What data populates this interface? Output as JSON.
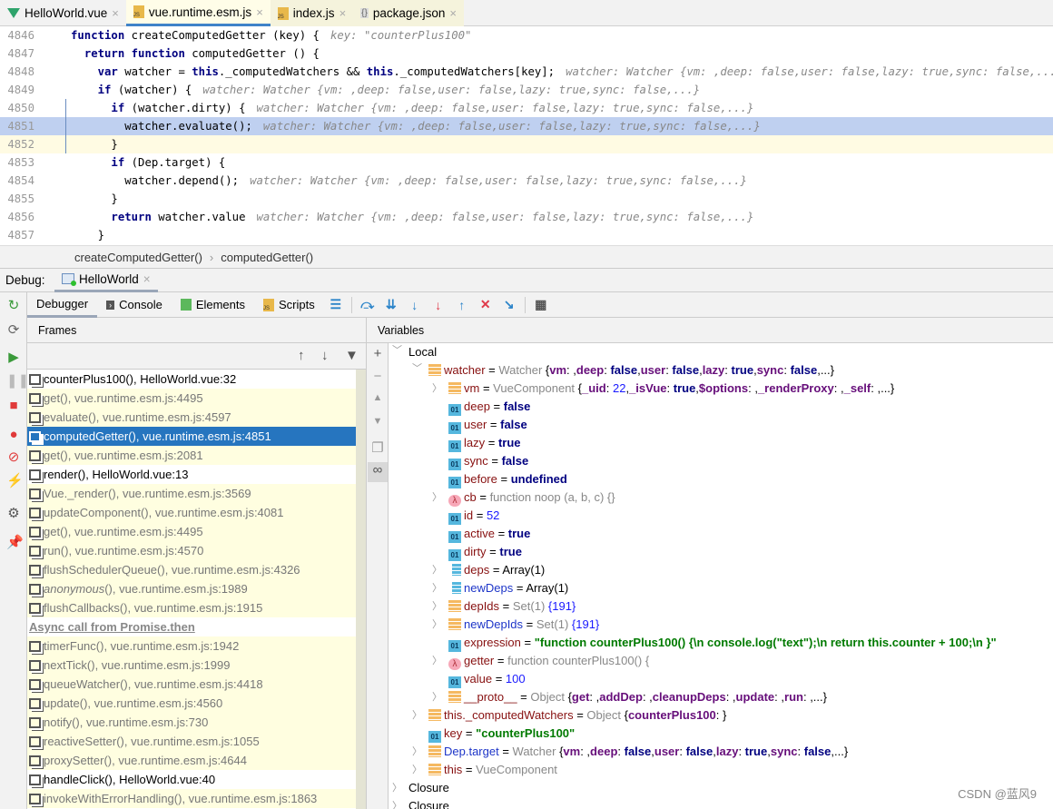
{
  "tabs": [
    {
      "label": "HelloWorld.vue",
      "icon": "vue-icon",
      "state": ""
    },
    {
      "label": "vue.runtime.esm.js",
      "icon": "js-file-icon",
      "state": "active"
    },
    {
      "label": "index.js",
      "icon": "js-file-icon",
      "state": "yellow"
    },
    {
      "label": "package.json",
      "icon": "json-file-icon",
      "state": "yellow"
    }
  ],
  "code": [
    {
      "num": "4846",
      "code": "function createComputedGetter (key) {",
      "hint": "key: \"counterPlus100\"",
      "state": ""
    },
    {
      "num": "4847",
      "code": "  return function computedGetter () {",
      "hint": "",
      "state": ""
    },
    {
      "num": "4848",
      "code": "    var watcher = this._computedWatchers && this._computedWatchers[key];",
      "hint": "watcher: Watcher {vm: ,deep: false,user: false,lazy: true,sync: false,...}  key: ",
      "state": ""
    },
    {
      "num": "4849",
      "code": "    if (watcher) {",
      "hint": "watcher: Watcher {vm: ,deep: false,user: false,lazy: true,sync: false,...}",
      "state": ""
    },
    {
      "num": "4850",
      "code": "      if (watcher.dirty) {",
      "hint": "watcher: Watcher {vm: ,deep: false,user: false,lazy: true,sync: false,...}",
      "state": ""
    },
    {
      "num": "4851",
      "code": "        watcher.evaluate();",
      "hint": "watcher: Watcher {vm: ,deep: false,user: false,lazy: true,sync: false,...}",
      "state": "exec"
    },
    {
      "num": "4852",
      "code": "      }",
      "hint": "",
      "state": "cur"
    },
    {
      "num": "4853",
      "code": "      if (Dep.target) {",
      "hint": "",
      "state": ""
    },
    {
      "num": "4854",
      "code": "        watcher.depend();",
      "hint": "watcher: Watcher {vm: ,deep: false,user: false,lazy: true,sync: false,...}",
      "state": ""
    },
    {
      "num": "4855",
      "code": "      }",
      "hint": "",
      "state": ""
    },
    {
      "num": "4856",
      "code": "      return watcher.value",
      "hint": "watcher: Watcher {vm: ,deep: false,user: false,lazy: true,sync: false,...}",
      "state": ""
    },
    {
      "num": "4857",
      "code": "    }",
      "hint": "",
      "state": ""
    }
  ],
  "breadcrumb": [
    "createComputedGetter()",
    "computedGetter()"
  ],
  "debug": {
    "label": "Debug:",
    "session": "HelloWorld"
  },
  "toolbar_tabs": [
    "Debugger",
    "Console",
    "Elements",
    "Scripts"
  ],
  "panels": {
    "frames": "Frames",
    "variables": "Variables"
  },
  "frames": [
    {
      "label": "counterPlus100(), HelloWorld.vue:32",
      "s": "w"
    },
    {
      "label": "get(), vue.runtime.esm.js:4495",
      "s": "y"
    },
    {
      "label": "evaluate(), vue.runtime.esm.js:4597",
      "s": "y"
    },
    {
      "label": "computedGetter(), vue.runtime.esm.js:4851",
      "s": "sel"
    },
    {
      "label": "get(), vue.runtime.esm.js:2081",
      "s": "y"
    },
    {
      "label": "render(), HelloWorld.vue:13",
      "s": "w"
    },
    {
      "label": "Vue._render(), vue.runtime.esm.js:3569",
      "s": "y"
    },
    {
      "label": "updateComponent(), vue.runtime.esm.js:4081",
      "s": "y"
    },
    {
      "label": "get(), vue.runtime.esm.js:4495",
      "s": "y"
    },
    {
      "label": "run(), vue.runtime.esm.js:4570",
      "s": "y"
    },
    {
      "label": "flushSchedulerQueue(), vue.runtime.esm.js:4326",
      "s": "y"
    },
    {
      "label": "anonymous(), vue.runtime.esm.js:1989",
      "s": "y"
    },
    {
      "label": "flushCallbacks(), vue.runtime.esm.js:1915",
      "s": "y"
    },
    {
      "label": "Async call from Promise.then",
      "s": "async"
    },
    {
      "label": "timerFunc(), vue.runtime.esm.js:1942",
      "s": "y"
    },
    {
      "label": "nextTick(), vue.runtime.esm.js:1999",
      "s": "y"
    },
    {
      "label": "queueWatcher(), vue.runtime.esm.js:4418",
      "s": "y"
    },
    {
      "label": "update(), vue.runtime.esm.js:4560",
      "s": "y"
    },
    {
      "label": "notify(), vue.runtime.esm.js:730",
      "s": "y"
    },
    {
      "label": "reactiveSetter(), vue.runtime.esm.js:1055",
      "s": "y"
    },
    {
      "label": "proxySetter(), vue.runtime.esm.js:4644",
      "s": "y"
    },
    {
      "label": "handleClick(), HelloWorld.vue:40",
      "s": "w"
    },
    {
      "label": "invokeWithErrorHandling(), vue.runtime.esm.js:1863",
      "s": "y"
    }
  ],
  "variables": [
    {
      "lvl": 0,
      "arrow": "open",
      "icon": "",
      "segs": [
        [
          "Local",
          "plain"
        ]
      ]
    },
    {
      "lvl": 1,
      "arrow": "open",
      "icon": "obj",
      "segs": [
        [
          "watcher",
          "name"
        ],
        [
          " = ",
          "plain"
        ],
        [
          "Watcher ",
          "gray"
        ],
        [
          "{",
          "plain"
        ],
        [
          "vm",
          "key"
        ],
        [
          ": ,",
          "plain"
        ],
        [
          "deep",
          "key"
        ],
        [
          ": ",
          "plain"
        ],
        [
          "false",
          "kw"
        ],
        [
          ",",
          "plain"
        ],
        [
          "user",
          "key"
        ],
        [
          ": ",
          "plain"
        ],
        [
          "false",
          "kw"
        ],
        [
          ",",
          "plain"
        ],
        [
          "lazy",
          "key"
        ],
        [
          ": ",
          "plain"
        ],
        [
          "true",
          "kw"
        ],
        [
          ",",
          "plain"
        ],
        [
          "sync",
          "key"
        ],
        [
          ": ",
          "plain"
        ],
        [
          "false",
          "kw"
        ],
        [
          ",...}",
          "plain"
        ]
      ]
    },
    {
      "lvl": 2,
      "arrow": "closed",
      "icon": "obj",
      "segs": [
        [
          "vm",
          "name"
        ],
        [
          " = ",
          "plain"
        ],
        [
          "VueComponent ",
          "gray"
        ],
        [
          "{",
          "plain"
        ],
        [
          "_uid",
          "key"
        ],
        [
          ": ",
          "plain"
        ],
        [
          "22",
          "num"
        ],
        [
          ",",
          "plain"
        ],
        [
          "_isVue",
          "key"
        ],
        [
          ": ",
          "plain"
        ],
        [
          "true",
          "kw"
        ],
        [
          ",",
          "plain"
        ],
        [
          "$options",
          "key"
        ],
        [
          ": ,",
          "plain"
        ],
        [
          "_renderProxy",
          "key"
        ],
        [
          ": ,",
          "plain"
        ],
        [
          "_self",
          "key"
        ],
        [
          ": ,...}",
          "plain"
        ]
      ]
    },
    {
      "lvl": 2,
      "arrow": "",
      "icon": "prim",
      "segs": [
        [
          "deep",
          "name"
        ],
        [
          " = ",
          "plain"
        ],
        [
          "false",
          "kw"
        ]
      ]
    },
    {
      "lvl": 2,
      "arrow": "",
      "icon": "prim",
      "segs": [
        [
          "user",
          "name"
        ],
        [
          " = ",
          "plain"
        ],
        [
          "false",
          "kw"
        ]
      ]
    },
    {
      "lvl": 2,
      "arrow": "",
      "icon": "prim",
      "segs": [
        [
          "lazy",
          "name"
        ],
        [
          " = ",
          "plain"
        ],
        [
          "true",
          "kw"
        ]
      ]
    },
    {
      "lvl": 2,
      "arrow": "",
      "icon": "prim",
      "segs": [
        [
          "sync",
          "name"
        ],
        [
          " = ",
          "plain"
        ],
        [
          "false",
          "kw"
        ]
      ]
    },
    {
      "lvl": 2,
      "arrow": "",
      "icon": "prim",
      "segs": [
        [
          "before",
          "name"
        ],
        [
          " = ",
          "plain"
        ],
        [
          "undefined",
          "kw"
        ]
      ]
    },
    {
      "lvl": 2,
      "arrow": "closed",
      "icon": "fn",
      "segs": [
        [
          "cb",
          "name"
        ],
        [
          " = ",
          "plain"
        ],
        [
          "function noop (a, b, c) {}",
          "gray"
        ]
      ]
    },
    {
      "lvl": 2,
      "arrow": "",
      "icon": "prim",
      "segs": [
        [
          "id",
          "name"
        ],
        [
          " = ",
          "plain"
        ],
        [
          "52",
          "num"
        ]
      ]
    },
    {
      "lvl": 2,
      "arrow": "",
      "icon": "prim",
      "segs": [
        [
          "active",
          "name"
        ],
        [
          " = ",
          "plain"
        ],
        [
          "true",
          "kw"
        ]
      ]
    },
    {
      "lvl": 2,
      "arrow": "",
      "icon": "prim",
      "segs": [
        [
          "dirty",
          "name"
        ],
        [
          " = ",
          "plain"
        ],
        [
          "true",
          "kw"
        ]
      ]
    },
    {
      "lvl": 2,
      "arrow": "closed",
      "icon": "arrx",
      "segs": [
        [
          "deps",
          "name"
        ],
        [
          " = ",
          "plain"
        ],
        [
          "Array(1)",
          "plain"
        ]
      ]
    },
    {
      "lvl": 2,
      "arrow": "closed",
      "icon": "arrx",
      "segs": [
        [
          "newDeps",
          "nameb"
        ],
        [
          " = ",
          "plain"
        ],
        [
          "Array(1)",
          "plain"
        ]
      ]
    },
    {
      "lvl": 2,
      "arrow": "closed",
      "icon": "obj",
      "segs": [
        [
          "depIds",
          "name"
        ],
        [
          " = ",
          "plain"
        ],
        [
          "Set(1) ",
          "gray"
        ],
        [
          "{191}",
          "num"
        ]
      ]
    },
    {
      "lvl": 2,
      "arrow": "closed",
      "icon": "obj",
      "segs": [
        [
          "newDepIds",
          "nameb"
        ],
        [
          " = ",
          "plain"
        ],
        [
          "Set(1) ",
          "gray"
        ],
        [
          "{191}",
          "num"
        ]
      ]
    },
    {
      "lvl": 2,
      "arrow": "",
      "icon": "prim",
      "segs": [
        [
          "expression",
          "name"
        ],
        [
          " = ",
          "plain"
        ],
        [
          "\"function counterPlus100() {\\n      console.log(\"text\");\\n      return this.counter + 100;\\n    }\"",
          "str"
        ]
      ]
    },
    {
      "lvl": 2,
      "arrow": "closed",
      "icon": "fn",
      "segs": [
        [
          "getter",
          "name"
        ],
        [
          " = ",
          "plain"
        ],
        [
          "function counterPlus100() {",
          "gray"
        ]
      ]
    },
    {
      "lvl": 2,
      "arrow": "",
      "icon": "prim",
      "segs": [
        [
          "value",
          "name"
        ],
        [
          " = ",
          "plain"
        ],
        [
          "100",
          "num"
        ]
      ]
    },
    {
      "lvl": 2,
      "arrow": "closed",
      "icon": "obj",
      "segs": [
        [
          "__proto__",
          "name"
        ],
        [
          " = ",
          "plain"
        ],
        [
          "Object ",
          "gray"
        ],
        [
          "{",
          "plain"
        ],
        [
          "get",
          "key"
        ],
        [
          ": ,",
          "plain"
        ],
        [
          "addDep",
          "key"
        ],
        [
          ": ,",
          "plain"
        ],
        [
          "cleanupDeps",
          "key"
        ],
        [
          ": ,",
          "plain"
        ],
        [
          "update",
          "key"
        ],
        [
          ": ,",
          "plain"
        ],
        [
          "run",
          "key"
        ],
        [
          ": ,...}",
          "plain"
        ]
      ]
    },
    {
      "lvl": 1,
      "arrow": "closed",
      "icon": "obj",
      "segs": [
        [
          "this._computedWatchers",
          "name"
        ],
        [
          " = ",
          "plain"
        ],
        [
          "Object ",
          "gray"
        ],
        [
          "{",
          "plain"
        ],
        [
          "counterPlus100",
          "key"
        ],
        [
          ": }",
          "plain"
        ]
      ]
    },
    {
      "lvl": 1,
      "arrow": "",
      "icon": "prim",
      "segs": [
        [
          "key",
          "name"
        ],
        [
          " = ",
          "plain"
        ],
        [
          "\"counterPlus100\"",
          "str"
        ]
      ]
    },
    {
      "lvl": 1,
      "arrow": "closed",
      "icon": "obj",
      "segs": [
        [
          "Dep.target",
          "nameb"
        ],
        [
          " = ",
          "plain"
        ],
        [
          "Watcher ",
          "gray"
        ],
        [
          "{",
          "plain"
        ],
        [
          "vm",
          "key"
        ],
        [
          ": ,",
          "plain"
        ],
        [
          "deep",
          "key"
        ],
        [
          ": ",
          "plain"
        ],
        [
          "false",
          "kw"
        ],
        [
          ",",
          "plain"
        ],
        [
          "user",
          "key"
        ],
        [
          ": ",
          "plain"
        ],
        [
          "false",
          "kw"
        ],
        [
          ",",
          "plain"
        ],
        [
          "lazy",
          "key"
        ],
        [
          ": ",
          "plain"
        ],
        [
          "true",
          "kw"
        ],
        [
          ",",
          "plain"
        ],
        [
          "sync",
          "key"
        ],
        [
          ": ",
          "plain"
        ],
        [
          "false",
          "kw"
        ],
        [
          ",...}",
          "plain"
        ]
      ]
    },
    {
      "lvl": 1,
      "arrow": "closed",
      "icon": "obj",
      "segs": [
        [
          "this",
          "name"
        ],
        [
          " = ",
          "plain"
        ],
        [
          "VueComponent",
          "gray"
        ]
      ]
    },
    {
      "lvl": 0,
      "arrow": "closed",
      "icon": "",
      "segs": [
        [
          "Closure",
          "plain"
        ]
      ]
    },
    {
      "lvl": 0,
      "arrow": "closed",
      "icon": "",
      "segs": [
        [
          "Closure",
          "plain"
        ]
      ]
    }
  ],
  "watermark": "CSDN @蓝风9"
}
